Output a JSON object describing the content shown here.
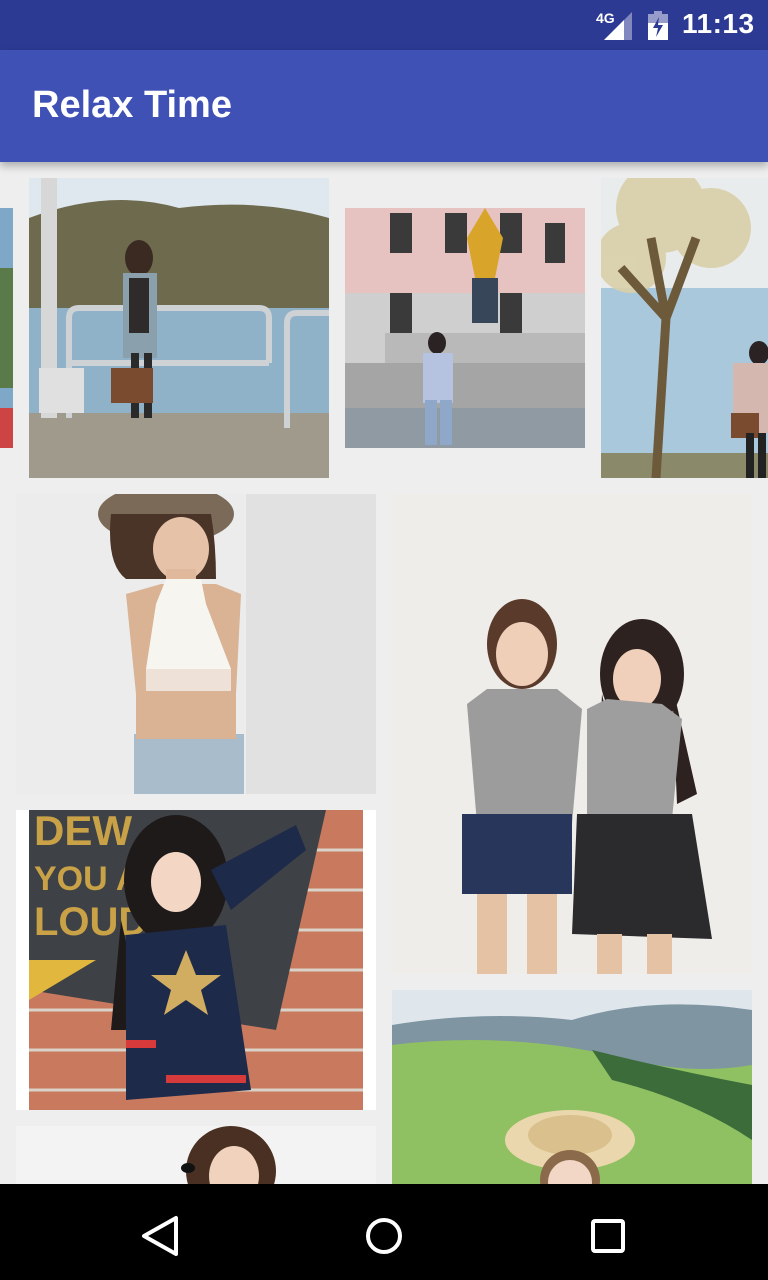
{
  "status_bar": {
    "network": "4G",
    "time": "11:13"
  },
  "app_bar": {
    "title": "Relax Time"
  },
  "colors": {
    "status_bar": "#2c3a94",
    "app_bar": "#3f51b5",
    "background": "#eeeeee",
    "nav_bar": "#000000"
  },
  "photos": [
    {
      "name": "photo-edge-left",
      "scene": "partial photo at left edge"
    },
    {
      "name": "photo-pier",
      "scene": "girl with bag on a pier by the water"
    },
    {
      "name": "photo-fountain",
      "scene": "girl sitting by a golden fountain statue"
    },
    {
      "name": "photo-tree",
      "scene": "girl beside a blossoming tree near a lake"
    },
    {
      "name": "photo-white-top",
      "scene": "girl in white crop top and hat"
    },
    {
      "name": "photo-two-girls",
      "scene": "two girls in grey tees against white wall"
    },
    {
      "name": "photo-brick-wall",
      "scene": "girl in star sweater before brick wall with 'YOU ARE LOUD' sign"
    },
    {
      "name": "photo-meadow",
      "scene": "girl in straw hat on green hillside"
    },
    {
      "name": "photo-partial-bottom",
      "scene": "girl with hair tie, partially visible"
    }
  ],
  "navigation": {
    "back_icon": "back-icon",
    "home_icon": "home-icon",
    "recents_icon": "recents-icon"
  }
}
